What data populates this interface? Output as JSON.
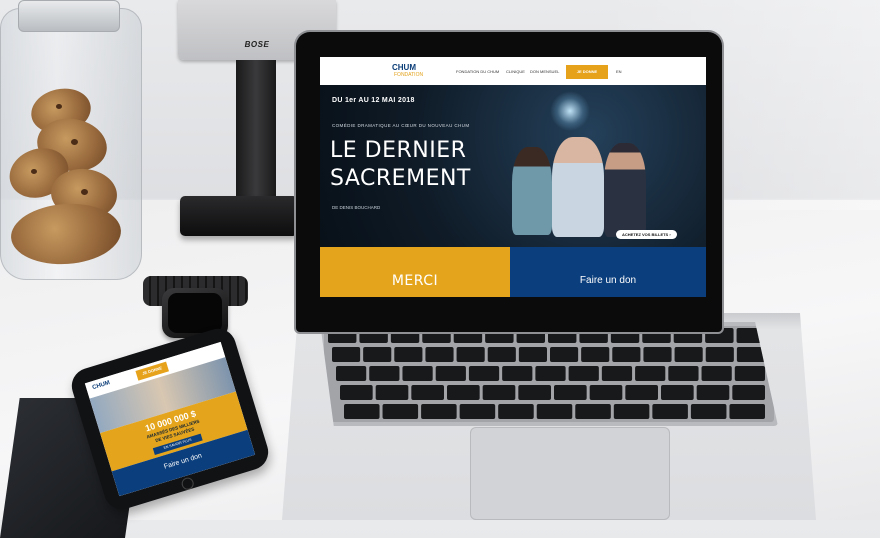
{
  "speaker": {
    "brand": "BOSE"
  },
  "laptop_site": {
    "logo": {
      "name": "CHUM",
      "tagline": "FONDATION"
    },
    "nav": {
      "links": [
        "FONDATION DU CHUM",
        "CLINIQUE",
        "DON MENSUEL"
      ],
      "button": "JE DONNE",
      "language": "EN"
    },
    "hero": {
      "date": "DU 1er AU 12 MAI 2018",
      "subtitle": "COMÉDIE DRAMATIQUE AU CŒUR DU NOUVEAU CHUM",
      "title_line1": "LE DERNIER",
      "title_line2": "SACREMENT",
      "author": "DE DENIS BOUCHARD",
      "cta": "ACHETEZ VOS BILLETS ›"
    },
    "tiles": {
      "left": "MERCI",
      "right": "Faire un don"
    }
  },
  "phone_site": {
    "logo": "CHUM",
    "nav_button": "JE DONNE",
    "amount": "10 000 000 $",
    "amount_sub_line1": "AMASSÉS DES MILLIERS",
    "amount_sub_line2": "DE VIES SAUVÉES",
    "button": "EN SAVOIR PLUS",
    "donate": "Faire un don"
  },
  "colors": {
    "brand_blue": "#0b3e7c",
    "brand_gold": "#e4a51d",
    "hero_dark": "#0f1b27"
  },
  "icons": [
    "speaker-icon",
    "cookie-jar-icon",
    "smartwatch-icon",
    "trackpad-icon"
  ]
}
